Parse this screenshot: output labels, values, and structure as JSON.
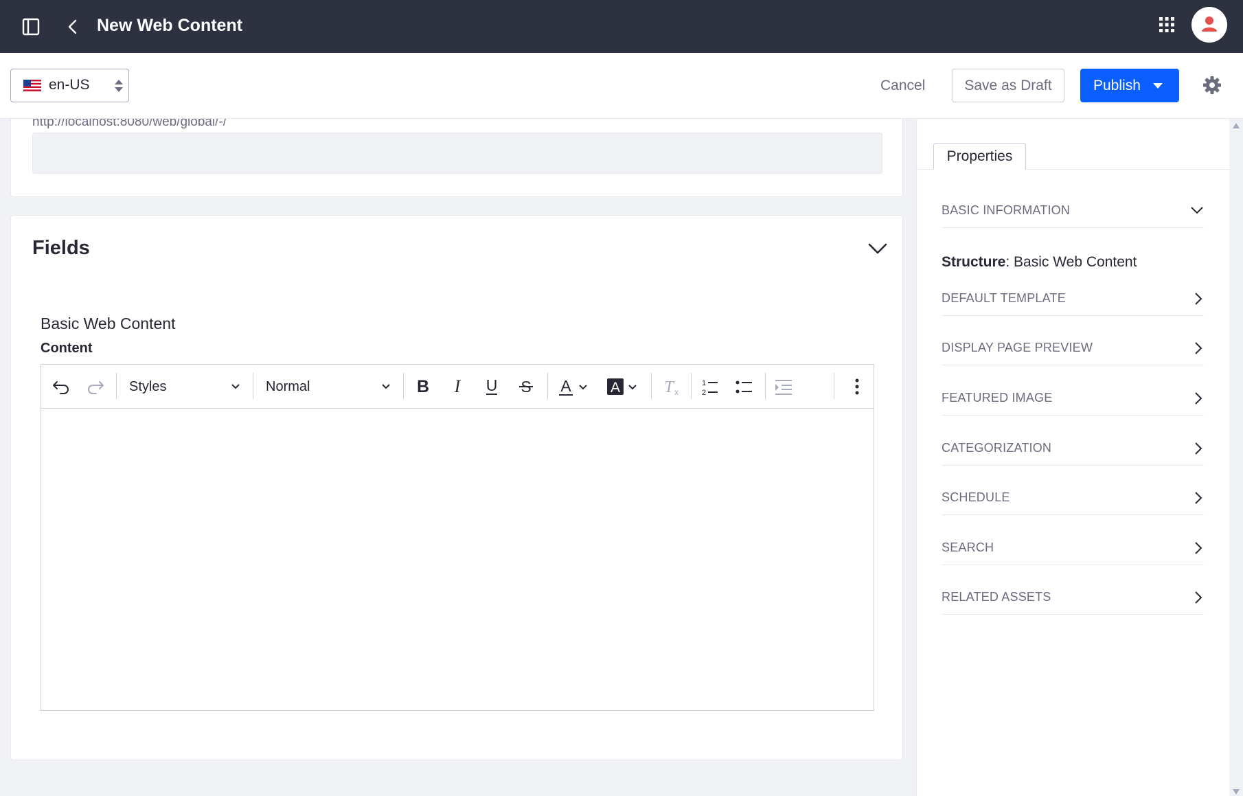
{
  "header": {
    "title": "New Web Content"
  },
  "toolbar": {
    "language": "en-US",
    "cancel_label": "Cancel",
    "save_draft_label": "Save as Draft",
    "publish_label": "Publish"
  },
  "url_section": {
    "url_prefix": "http://localhost:8080/web/global/-/"
  },
  "fields": {
    "title": "Fields",
    "structure_name": "Basic Web Content",
    "content_label": "Content",
    "editor": {
      "styles_label": "Styles",
      "format_label": "Normal"
    }
  },
  "sidebar": {
    "tab_label": "Properties",
    "basic_information": "BASIC INFORMATION",
    "structure_key": "Structure",
    "structure_value": ": Basic Web Content",
    "sections": [
      {
        "label": "DEFAULT TEMPLATE"
      },
      {
        "label": "DISPLAY PAGE PREVIEW"
      },
      {
        "label": "FEATURED IMAGE"
      },
      {
        "label": "CATEGORIZATION"
      },
      {
        "label": "SCHEDULE"
      },
      {
        "label": "SEARCH"
      },
      {
        "label": "RELATED ASSETS"
      }
    ]
  },
  "colors": {
    "topbar": "#2e3140",
    "primary": "#0b5fff",
    "avatar_accent": "#e5504c"
  }
}
